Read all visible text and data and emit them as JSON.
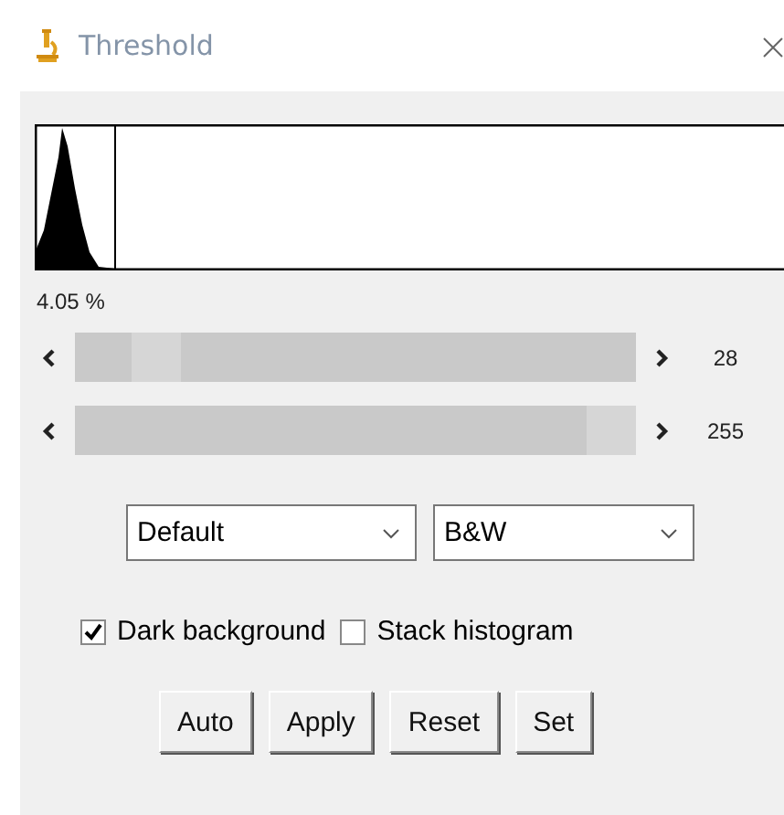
{
  "window": {
    "title": "Threshold"
  },
  "histogram": {
    "percent": "4.05 %"
  },
  "sliders": [
    {
      "level": 0.11,
      "reading": "28"
    },
    {
      "level": 1.0,
      "reading": "255"
    }
  ],
  "dropdowns": [
    {
      "value": "Default"
    },
    {
      "value": "B&W"
    }
  ],
  "checkboxes": [
    {
      "label": "Dark background",
      "checked": true
    },
    {
      "label": "Stack histogram",
      "checked": false
    }
  ],
  "buttons": [
    "Auto",
    "Apply",
    "Reset",
    "Set"
  ]
}
